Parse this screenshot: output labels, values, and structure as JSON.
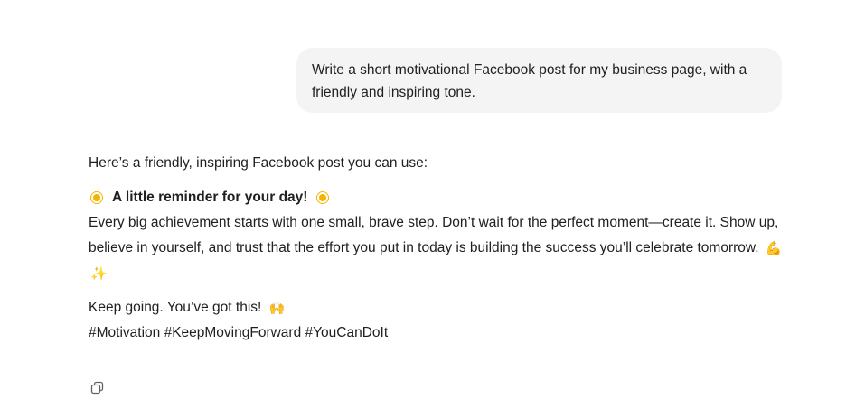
{
  "user_message": "Write a short motivational Facebook post for my business page, with a friendly and inspiring tone.",
  "response": {
    "intro": "Here’s a friendly, inspiring Facebook post you can use:",
    "headline": "A little reminder for your day!",
    "body": "Every big achievement starts with one small, brave step. Don’t wait for the perfect moment—create it. Show up, believe in yourself, and trust that the effort you put in today is building the success you’ll celebrate tomorrow.",
    "closing": "Keep going. You’ve got this!",
    "hashtags": "#Motivation #KeepMovingForward #YouCanDoIt"
  },
  "icons": {
    "headline_left": "sun-icon",
    "headline_right": "sun-icon",
    "body_end_1": "flexed-biceps-icon",
    "body_end_2": "sparkles-icon",
    "closing_end": "raised-hands-icon",
    "copy": "copy-icon"
  },
  "colors": {
    "user_bubble_bg": "#f4f4f4",
    "text": "#202020",
    "emoji_yellow": "#f4b400",
    "icon_gray": "#5f6368"
  }
}
